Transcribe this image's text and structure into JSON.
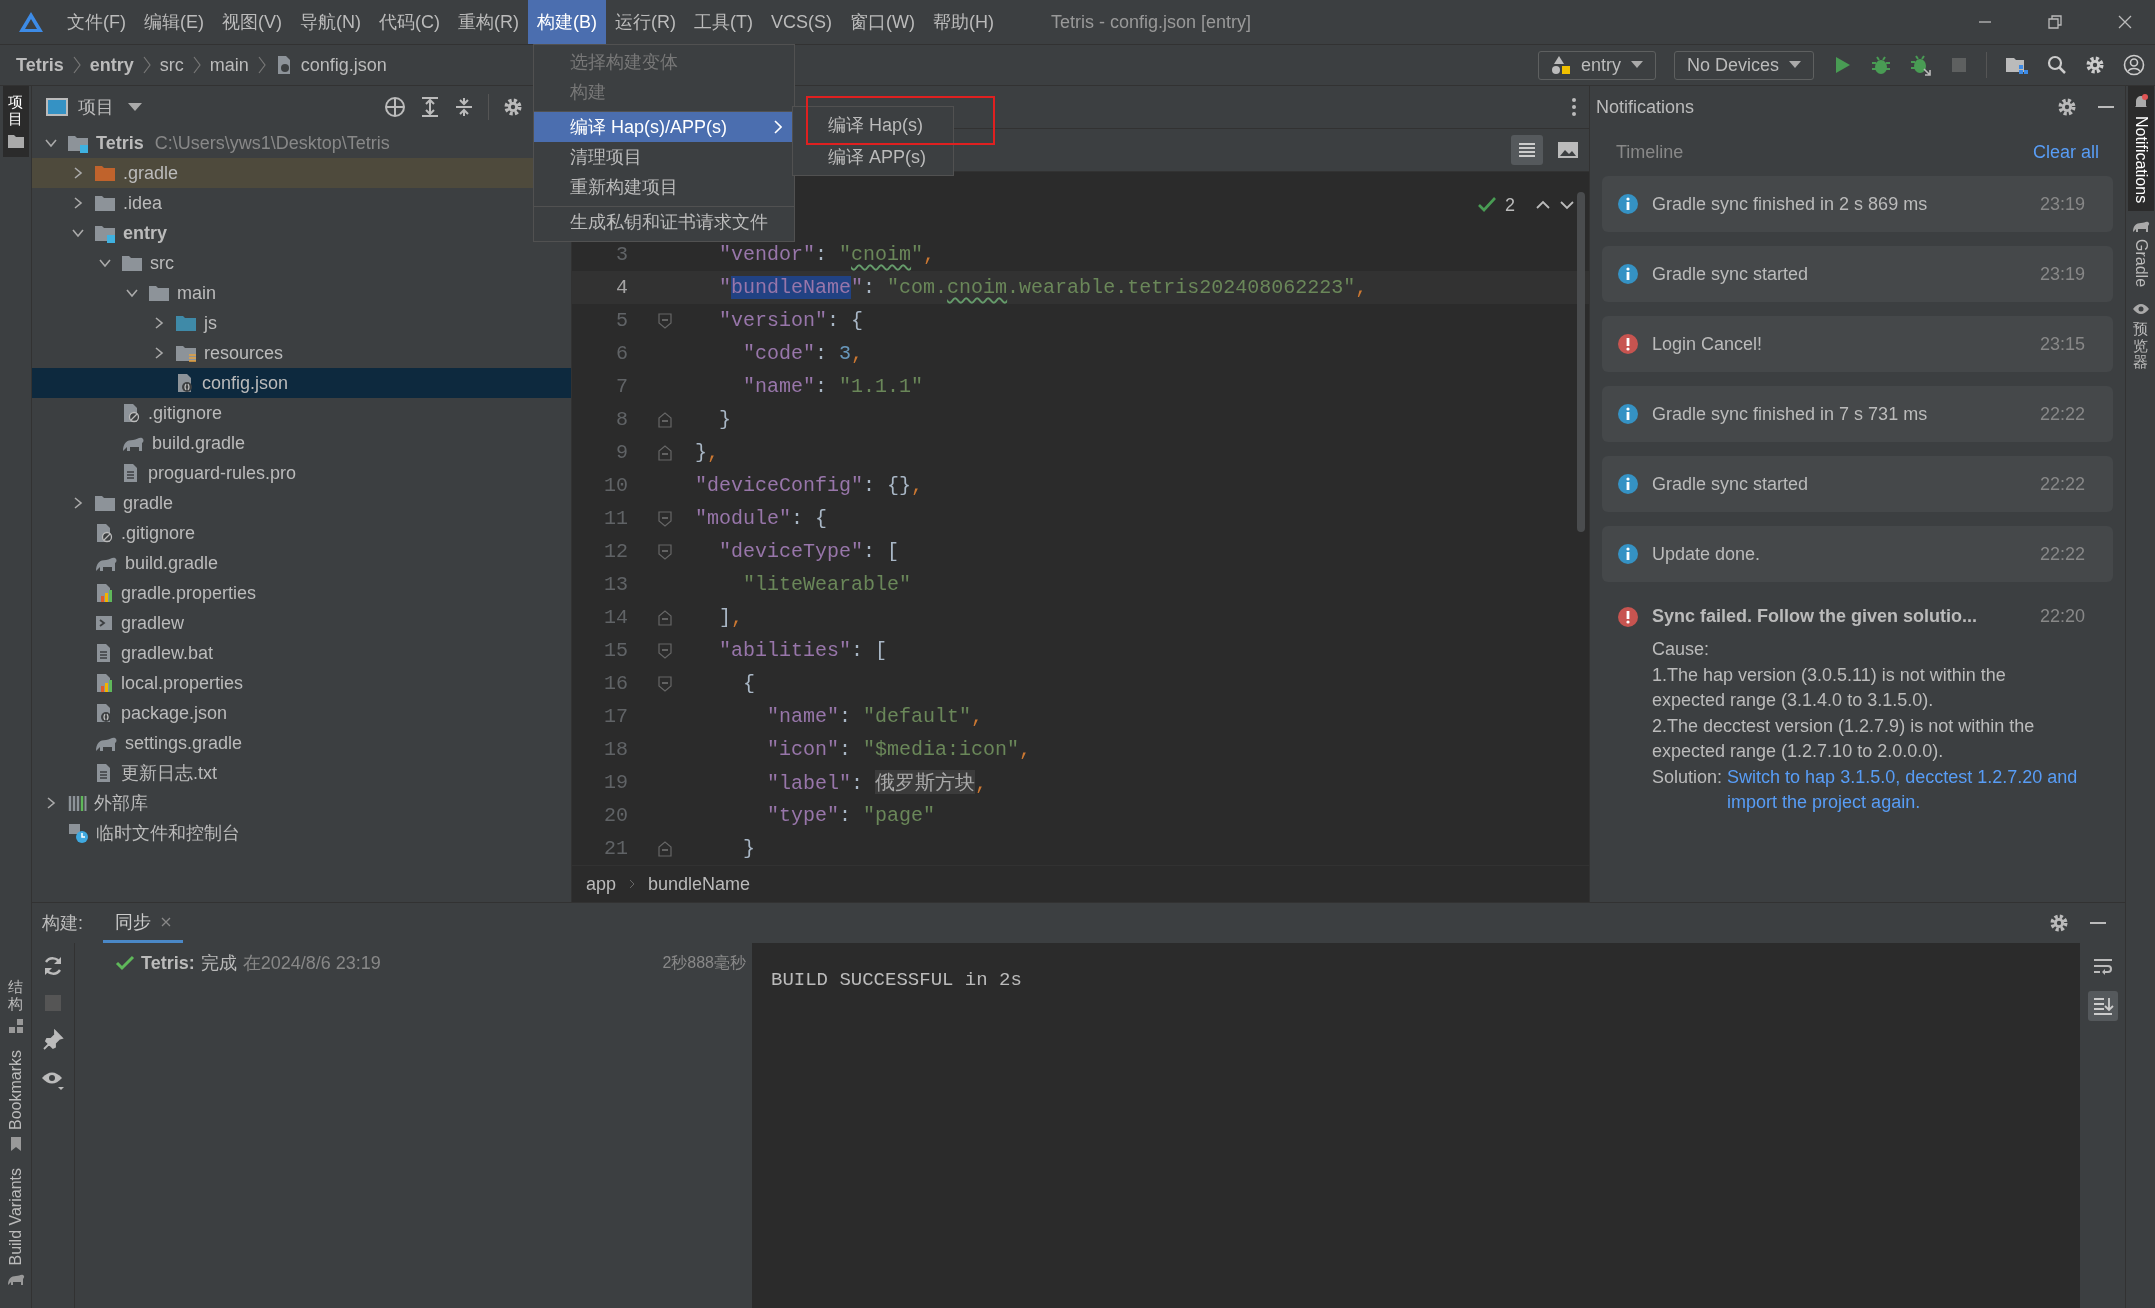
{
  "window": {
    "title": "Tetris - config.json [entry]"
  },
  "menu_bar": [
    {
      "label": "文件(F)",
      "selected": false
    },
    {
      "label": "编辑(E)",
      "selected": false
    },
    {
      "label": "视图(V)",
      "selected": false
    },
    {
      "label": "导航(N)",
      "selected": false
    },
    {
      "label": "代码(C)",
      "selected": false
    },
    {
      "label": "重构(R)",
      "selected": false
    },
    {
      "label": "构建(B)",
      "selected": true
    },
    {
      "label": "运行(R)",
      "selected": false
    },
    {
      "label": "工具(T)",
      "selected": false
    },
    {
      "label": "VCS(S)",
      "selected": false
    },
    {
      "label": "窗口(W)",
      "selected": false
    },
    {
      "label": "帮助(H)",
      "selected": false
    }
  ],
  "build_menu": {
    "items": [
      {
        "label": "选择构建变体",
        "disabled": true,
        "selected": false,
        "submenu": false,
        "separator_before": false
      },
      {
        "label": "构建",
        "disabled": true,
        "selected": false,
        "submenu": false,
        "separator_before": false
      },
      {
        "label": "编译 Hap(s)/APP(s)",
        "disabled": false,
        "selected": true,
        "submenu": true,
        "separator_before": true
      },
      {
        "label": "清理项目",
        "disabled": false,
        "selected": false,
        "submenu": false,
        "separator_before": false
      },
      {
        "label": "重新构建项目",
        "disabled": false,
        "selected": false,
        "submenu": false,
        "separator_before": false
      },
      {
        "label": "生成私钥和证书请求文件",
        "disabled": false,
        "selected": false,
        "submenu": false,
        "separator_before": true
      }
    ],
    "submenu": [
      {
        "label": "编译 Hap(s)",
        "highlighted": true
      },
      {
        "label": "编译 APP(s)",
        "highlighted": false
      }
    ]
  },
  "breadcrumb": [
    {
      "label": "Tetris",
      "kind": "project"
    },
    {
      "label": "entry",
      "kind": "module"
    },
    {
      "label": "src",
      "kind": "folder"
    },
    {
      "label": "main",
      "kind": "folder"
    },
    {
      "label": "config.json",
      "kind": "file"
    }
  ],
  "toolbar": {
    "module": "entry",
    "device": "No Devices"
  },
  "left_strip": {
    "top": [
      {
        "label": "项目",
        "selected": true
      }
    ],
    "bottom": [
      {
        "label": "结构",
        "kind": "cjk",
        "selected": false
      },
      {
        "label": "Bookmarks",
        "kind": "latin",
        "selected": false
      },
      {
        "label": "Build Variants",
        "kind": "latin",
        "selected": false
      }
    ]
  },
  "right_strip": [
    {
      "label": "Notifications",
      "kind": "latin",
      "selected": true
    },
    {
      "label": "Gradle",
      "kind": "latin",
      "selected": false
    },
    {
      "label": "预览器",
      "kind": "cjk",
      "selected": false
    }
  ],
  "project_panel": {
    "title": "项目",
    "tree": [
      {
        "name": "Tetris",
        "path": "C:\\Users\\yws1\\Desktop\\Tetris",
        "kind": "module",
        "expanded": true,
        "selected": false,
        "children": [
          {
            "name": ".gradle",
            "kind": "excluded",
            "expanded": false,
            "selected": false
          },
          {
            "name": ".idea",
            "kind": "folder",
            "expanded": false,
            "selected": false
          },
          {
            "name": "entry",
            "kind": "module",
            "expanded": true,
            "selected": false,
            "children": [
              {
                "name": "src",
                "kind": "folder",
                "expanded": true,
                "selected": false,
                "children": [
                  {
                    "name": "main",
                    "kind": "folder",
                    "expanded": true,
                    "selected": false,
                    "children": [
                      {
                        "name": "js",
                        "kind": "source",
                        "expanded": false,
                        "selected": false
                      },
                      {
                        "name": "resources",
                        "kind": "resources",
                        "expanded": false,
                        "selected": false
                      },
                      {
                        "name": "config.json",
                        "kind": "json",
                        "selected": true
                      }
                    ]
                  }
                ]
              },
              {
                "name": ".gitignore",
                "kind": "ignore",
                "selected": false
              },
              {
                "name": "build.gradle",
                "kind": "gradle",
                "selected": false
              },
              {
                "name": "proguard-rules.pro",
                "kind": "text",
                "selected": false
              }
            ]
          },
          {
            "name": "gradle",
            "kind": "folder",
            "expanded": false,
            "selected": false
          },
          {
            "name": ".gitignore",
            "kind": "ignore",
            "selected": false
          },
          {
            "name": "build.gradle",
            "kind": "gradle",
            "selected": false
          },
          {
            "name": "gradle.properties",
            "kind": "properties",
            "selected": false
          },
          {
            "name": "gradlew",
            "kind": "script",
            "selected": false
          },
          {
            "name": "gradlew.bat",
            "kind": "text",
            "selected": false
          },
          {
            "name": "local.properties",
            "kind": "properties",
            "selected": false
          },
          {
            "name": "package.json",
            "kind": "json",
            "selected": false
          },
          {
            "name": "settings.gradle",
            "kind": "gradle",
            "selected": false
          },
          {
            "name": "更新日志.txt",
            "kind": "text",
            "selected": false
          }
        ]
      },
      {
        "name": "外部库",
        "kind": "library",
        "expanded": false,
        "selected": false
      },
      {
        "name": "临时文件和控制台",
        "kind": "scratch",
        "selected": false
      }
    ]
  },
  "editor": {
    "inspection_count": "2",
    "lines": [
      {
        "number": "3",
        "current": false,
        "fold_start": false,
        "fold_end": false,
        "tokens": [
          {
            "text": "  \"vendor\"",
            "kind": "key"
          },
          {
            "text": ": ",
            "kind": "punct"
          },
          {
            "text": "\"",
            "kind": "string"
          },
          {
            "text": "cnoim",
            "kind": "typo"
          },
          {
            "text": "\"",
            "kind": "string"
          },
          {
            "text": ",",
            "kind": "comma"
          }
        ]
      },
      {
        "number": "4",
        "current": true,
        "fold_start": false,
        "fold_end": false,
        "tokens": [
          {
            "text": "  \"",
            "kind": "key"
          },
          {
            "text": "bundleName",
            "kind": "match"
          },
          {
            "text": "\"",
            "kind": "key"
          },
          {
            "text": ": ",
            "kind": "punct"
          },
          {
            "text": "\"com.",
            "kind": "string"
          },
          {
            "text": "cnoim",
            "kind": "typo"
          },
          {
            "text": ".wearable.tetris202408062223\"",
            "kind": "string"
          },
          {
            "text": ",",
            "kind": "comma"
          }
        ]
      },
      {
        "number": "5",
        "current": false,
        "fold_start": true,
        "fold_end": false,
        "tokens": [
          {
            "text": "  \"version\"",
            "kind": "key"
          },
          {
            "text": ": {",
            "kind": "punct"
          }
        ]
      },
      {
        "number": "6",
        "current": false,
        "fold_start": false,
        "fold_end": false,
        "tokens": [
          {
            "text": "    \"code\"",
            "kind": "key"
          },
          {
            "text": ": ",
            "kind": "punct"
          },
          {
            "text": "3",
            "kind": "number"
          },
          {
            "text": ",",
            "kind": "comma"
          }
        ]
      },
      {
        "number": "7",
        "current": false,
        "fold_start": false,
        "fold_end": false,
        "tokens": [
          {
            "text": "    \"name\"",
            "kind": "key"
          },
          {
            "text": ": ",
            "kind": "punct"
          },
          {
            "text": "\"1.1.1\"",
            "kind": "string"
          }
        ]
      },
      {
        "number": "8",
        "current": false,
        "fold_start": false,
        "fold_end": true,
        "tokens": [
          {
            "text": "  }",
            "kind": "punct"
          }
        ]
      },
      {
        "number": "9",
        "current": false,
        "fold_start": false,
        "fold_end": true,
        "tokens": [
          {
            "text": "}",
            "kind": "punct"
          },
          {
            "text": ",",
            "kind": "comma"
          }
        ]
      },
      {
        "number": "10",
        "current": false,
        "fold_start": false,
        "fold_end": false,
        "tokens": [
          {
            "text": "\"deviceConfig\"",
            "kind": "key"
          },
          {
            "text": ": {}",
            "kind": "punct"
          },
          {
            "text": ",",
            "kind": "comma"
          }
        ]
      },
      {
        "number": "11",
        "current": false,
        "fold_start": true,
        "fold_end": false,
        "tokens": [
          {
            "text": "\"module\"",
            "kind": "key"
          },
          {
            "text": ": {",
            "kind": "punct"
          }
        ]
      },
      {
        "number": "12",
        "current": false,
        "fold_start": true,
        "fold_end": false,
        "tokens": [
          {
            "text": "  \"deviceType\"",
            "kind": "key"
          },
          {
            "text": ": [",
            "kind": "punct"
          }
        ]
      },
      {
        "number": "13",
        "current": false,
        "fold_start": false,
        "fold_end": false,
        "tokens": [
          {
            "text": "    \"liteWearable\"",
            "kind": "string"
          }
        ]
      },
      {
        "number": "14",
        "current": false,
        "fold_start": false,
        "fold_end": true,
        "tokens": [
          {
            "text": "  ]",
            "kind": "punct"
          },
          {
            "text": ",",
            "kind": "comma"
          }
        ]
      },
      {
        "number": "15",
        "current": false,
        "fold_start": true,
        "fold_end": false,
        "tokens": [
          {
            "text": "  \"abilities\"",
            "kind": "key"
          },
          {
            "text": ": [",
            "kind": "punct"
          }
        ]
      },
      {
        "number": "16",
        "current": false,
        "fold_start": true,
        "fold_end": false,
        "tokens": [
          {
            "text": "    {",
            "kind": "punct"
          }
        ]
      },
      {
        "number": "17",
        "current": false,
        "fold_start": false,
        "fold_end": false,
        "tokens": [
          {
            "text": "      \"name\"",
            "kind": "key"
          },
          {
            "text": ": ",
            "kind": "punct"
          },
          {
            "text": "\"default\"",
            "kind": "string"
          },
          {
            "text": ",",
            "kind": "comma"
          }
        ]
      },
      {
        "number": "18",
        "current": false,
        "fold_start": false,
        "fold_end": false,
        "tokens": [
          {
            "text": "      \"icon\"",
            "kind": "key"
          },
          {
            "text": ": ",
            "kind": "punct"
          },
          {
            "text": "\"$media:icon\"",
            "kind": "string"
          },
          {
            "text": ",",
            "kind": "comma"
          }
        ]
      },
      {
        "number": "19",
        "current": false,
        "fold_start": false,
        "fold_end": false,
        "tokens": [
          {
            "text": "      \"label\"",
            "kind": "key"
          },
          {
            "text": ": ",
            "kind": "punct"
          },
          {
            "text": "俄罗斯方块",
            "kind": "folded"
          },
          {
            "text": ",",
            "kind": "comma"
          }
        ]
      },
      {
        "number": "20",
        "current": false,
        "fold_start": false,
        "fold_end": false,
        "tokens": [
          {
            "text": "      \"type\"",
            "kind": "key"
          },
          {
            "text": ": ",
            "kind": "punct"
          },
          {
            "text": "\"page\"",
            "kind": "string"
          }
        ]
      },
      {
        "number": "21",
        "current": false,
        "fold_start": false,
        "fold_end": true,
        "tokens": [
          {
            "text": "    }",
            "kind": "punct"
          }
        ]
      }
    ],
    "breadcrumb": [
      "app",
      "bundleName"
    ]
  },
  "notifications": {
    "title": "Notifications",
    "timeline": "Timeline",
    "clear_all": "Clear all",
    "items": [
      {
        "kind": "info",
        "text": "Gradle sync finished in 2 s 869 ms",
        "time": "23:19",
        "expanded": false
      },
      {
        "kind": "info",
        "text": "Gradle sync started",
        "time": "23:19",
        "expanded": false
      },
      {
        "kind": "error",
        "text": "Login Cancel!",
        "time": "23:15",
        "expanded": false
      },
      {
        "kind": "info",
        "text": "Gradle sync finished in 7 s 731 ms",
        "time": "22:22",
        "expanded": false
      },
      {
        "kind": "info",
        "text": "Gradle sync started",
        "time": "22:22",
        "expanded": false
      },
      {
        "kind": "info",
        "text": "Update done.",
        "time": "22:22",
        "expanded": false
      },
      {
        "kind": "error",
        "text": "Sync failed. Follow the given solutio...",
        "time": "22:20",
        "expanded": true,
        "body": [
          "Cause:",
          "1.The hap version (3.0.5.11) is not within the expected range (3.1.4.0 to 3.1.5.0).",
          "2.The decctest version (1.2.7.9) is not within the expected range (1.2.7.10 to 2.0.0.0)."
        ],
        "solution_label": "Solution:",
        "solution_link": "Switch to hap 3.1.5.0, decctest 1.2.7.20 and import the project again."
      }
    ]
  },
  "build_panel": {
    "label": "构建:",
    "tabs": [
      {
        "label": "同步",
        "selected": true
      }
    ],
    "result": {
      "success": true,
      "project": "Tetris:",
      "status": "完成",
      "time": "在2024/8/6 23:19",
      "duration": "2秒888毫秒"
    },
    "console": "BUILD SUCCESSFUL in 2s"
  }
}
